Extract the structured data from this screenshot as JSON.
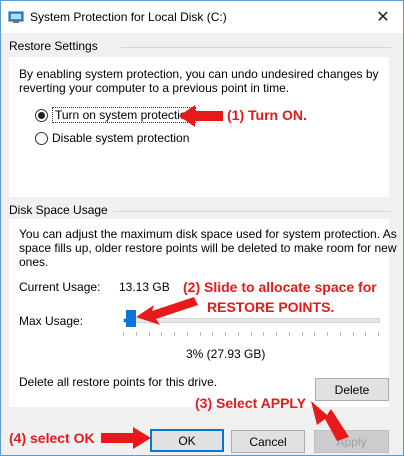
{
  "window": {
    "title": "System Protection for Local Disk (C:)",
    "close_glyph": "✕"
  },
  "restore_settings": {
    "heading": "Restore Settings",
    "description_line1": "By enabling system protection, you can undo undesired changes by",
    "description_line2": "reverting your computer to a previous point in time.",
    "options": [
      {
        "label": "Turn on system protection",
        "selected": true
      },
      {
        "label": "Disable system protection",
        "selected": false
      }
    ]
  },
  "disk_space": {
    "heading": "Disk Space Usage",
    "description_line1": "You can adjust the maximum disk space used for system protection. As",
    "description_line2": "space fills up, older restore points will be deleted to make room for new",
    "description_line3": "ones.",
    "current_usage_label": "Current Usage:",
    "current_usage_value": "13.13 GB",
    "max_usage_label": "Max Usage:",
    "max_usage_fraction": 0.03,
    "max_usage_text": "3% (27.93 GB)",
    "delete_text": "Delete all restore points for this drive.",
    "delete_button": "Delete"
  },
  "buttons": {
    "ok": "OK",
    "cancel": "Cancel",
    "apply": "Apply"
  },
  "annotations": {
    "step1": "(1) Turn ON.",
    "step2_line1": "(2) Slide to allocate space for",
    "step2_line2": "RESTORE POINTS.",
    "step3": "(3) Select APPLY",
    "step4": "(4) select OK",
    "color": "#e8191a"
  },
  "icons": {
    "app": "system-protection-shield-icon",
    "close": "close-icon"
  }
}
